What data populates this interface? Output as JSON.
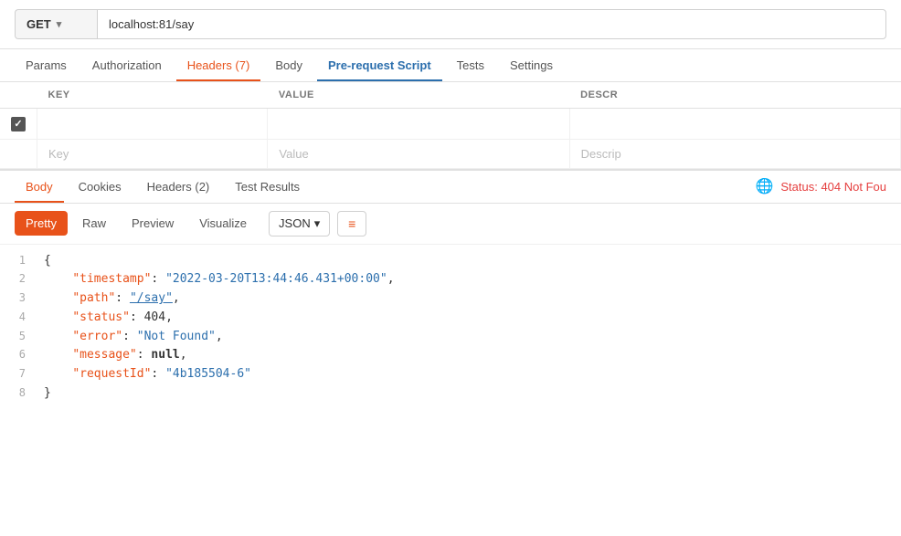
{
  "urlBar": {
    "method": "GET",
    "url": "localhost:81/say",
    "chevron": "▾"
  },
  "requestTabs": [
    {
      "id": "params",
      "label": "Params",
      "active": false
    },
    {
      "id": "authorization",
      "label": "Authorization",
      "active": false
    },
    {
      "id": "headers",
      "label": "Headers (7)",
      "active": true
    },
    {
      "id": "body",
      "label": "Body",
      "active": false
    },
    {
      "id": "prerequest",
      "label": "Pre-request Script",
      "active": false
    },
    {
      "id": "tests",
      "label": "Tests",
      "active": false
    },
    {
      "id": "settings",
      "label": "Settings",
      "active": false
    }
  ],
  "headersTable": {
    "columns": [
      "KEY",
      "VALUE",
      "DESCR"
    ],
    "rows": [
      {
        "checked": true,
        "key": "",
        "value": "",
        "description": ""
      }
    ],
    "emptyRow": {
      "key": "Key",
      "value": "Value",
      "description": "Descrip"
    }
  },
  "responseTabs": [
    {
      "id": "body",
      "label": "Body",
      "active": true
    },
    {
      "id": "cookies",
      "label": "Cookies",
      "active": false
    },
    {
      "id": "headers",
      "label": "Headers (2)",
      "active": false
    },
    {
      "id": "testresults",
      "label": "Test Results",
      "active": false
    }
  ],
  "statusBadge": {
    "text": "Status: 404 Not Fou"
  },
  "formatTabs": [
    {
      "id": "pretty",
      "label": "Pretty",
      "active": true
    },
    {
      "id": "raw",
      "label": "Raw",
      "active": false
    },
    {
      "id": "preview",
      "label": "Preview",
      "active": false
    },
    {
      "id": "visualize",
      "label": "Visualize",
      "active": false
    }
  ],
  "jsonSelector": {
    "value": "JSON",
    "chevron": "▾"
  },
  "codeLines": [
    {
      "num": 1,
      "content": "{",
      "type": "brace"
    },
    {
      "num": 2,
      "content": "\"timestamp\": \"2022-03-20T13:44:46.431+00:00\",",
      "type": "keystr"
    },
    {
      "num": 3,
      "content": "\"path\": \"/say\",",
      "type": "keylink"
    },
    {
      "num": 4,
      "content": "\"status\": 404,",
      "type": "keynum"
    },
    {
      "num": 5,
      "content": "\"error\": \"Not Found\",",
      "type": "keystr2"
    },
    {
      "num": 6,
      "content": "\"message\": null,",
      "type": "keynull"
    },
    {
      "num": 7,
      "content": "\"requestId\": \"4b185504-6\"",
      "type": "keystr3"
    },
    {
      "num": 8,
      "content": "}",
      "type": "brace"
    }
  ]
}
